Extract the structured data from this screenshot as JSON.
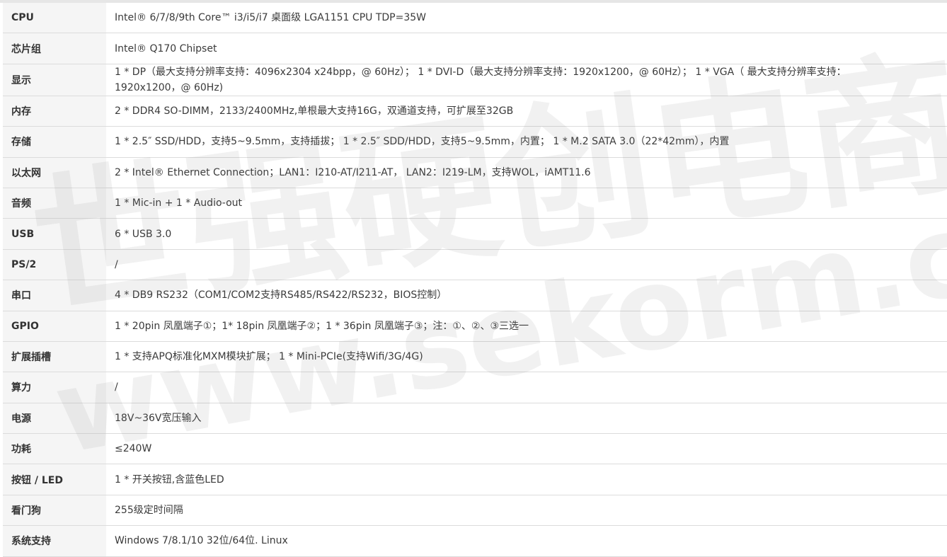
{
  "specs": [
    {
      "label": "CPU",
      "value": "Intel® 6/7/8/9th Core™ i3/i5/i7 桌面级 LGA1151 CPU TDP=35W"
    },
    {
      "label": "芯片组",
      "value": "Intel® Q170 Chipset"
    },
    {
      "label": "显示",
      "value": "1 * DP（最大支持分辨率支持：4096x2304 x24bpp，@ 60Hz）； 1 * DVI-D（最大支持分辨率支持：1920x1200，@ 60Hz）； 1 * VGA（ 最大支持分辨率支持：1920x1200，@ 60Hz)"
    },
    {
      "label": "内存",
      "value": "2 * DDR4 SO-DIMM，2133/2400MHz,单根最大支持16G，双通道支持，可扩展至32GB"
    },
    {
      "label": "存储",
      "value": "1 * 2.5″ SSD/HDD，支持5~9.5mm，支持插拔； 1 * 2.5″ SDD/HDD，支持5~9.5mm，内置； 1 * M.2 SATA 3.0（22*42mm），内置"
    },
    {
      "label": "以太网",
      "value": "2 * Intel® Ethernet Connection；LAN1：I210-AT/I211-AT， LAN2：I219-LM，支持WOL，iAMT11.6"
    },
    {
      "label": "音频",
      "value": "1 * Mic-in + 1 * Audio-out"
    },
    {
      "label": "USB",
      "value": "6 * USB 3.0"
    },
    {
      "label": "PS/2",
      "value": "/"
    },
    {
      "label": "串口",
      "value": "4 * DB9 RS232（COM1/COM2支持RS485/RS422/RS232，BIOS控制）"
    },
    {
      "label": "GPIO",
      "value": "1 * 20pin 凤凰端子①；1* 18pin 凤凰端子②；1 * 36pin 凤凰端子③；注：①、②、③三选一"
    },
    {
      "label": "扩展插槽",
      "value": "1 * 支持APQ标准化MXM模块扩展； 1 * Mini-PCIe(支持Wifi/3G/4G)"
    },
    {
      "label": "算力",
      "value": "/"
    },
    {
      "label": "电源",
      "value": "18V~36V宽压输入"
    },
    {
      "label": "功耗",
      "value": "≤240W"
    },
    {
      "label": "按钮 / LED",
      "value": "1 * 开关按钮,含蓝色LED"
    },
    {
      "label": "看门狗",
      "value": "255级定时间隔"
    },
    {
      "label": "系统支持",
      "value": "Windows 7/8.1/10 32位/64位. Linux"
    }
  ],
  "watermark": {
    "line1": "世强硬创电商",
    "line2": "www.sekorm.com"
  }
}
